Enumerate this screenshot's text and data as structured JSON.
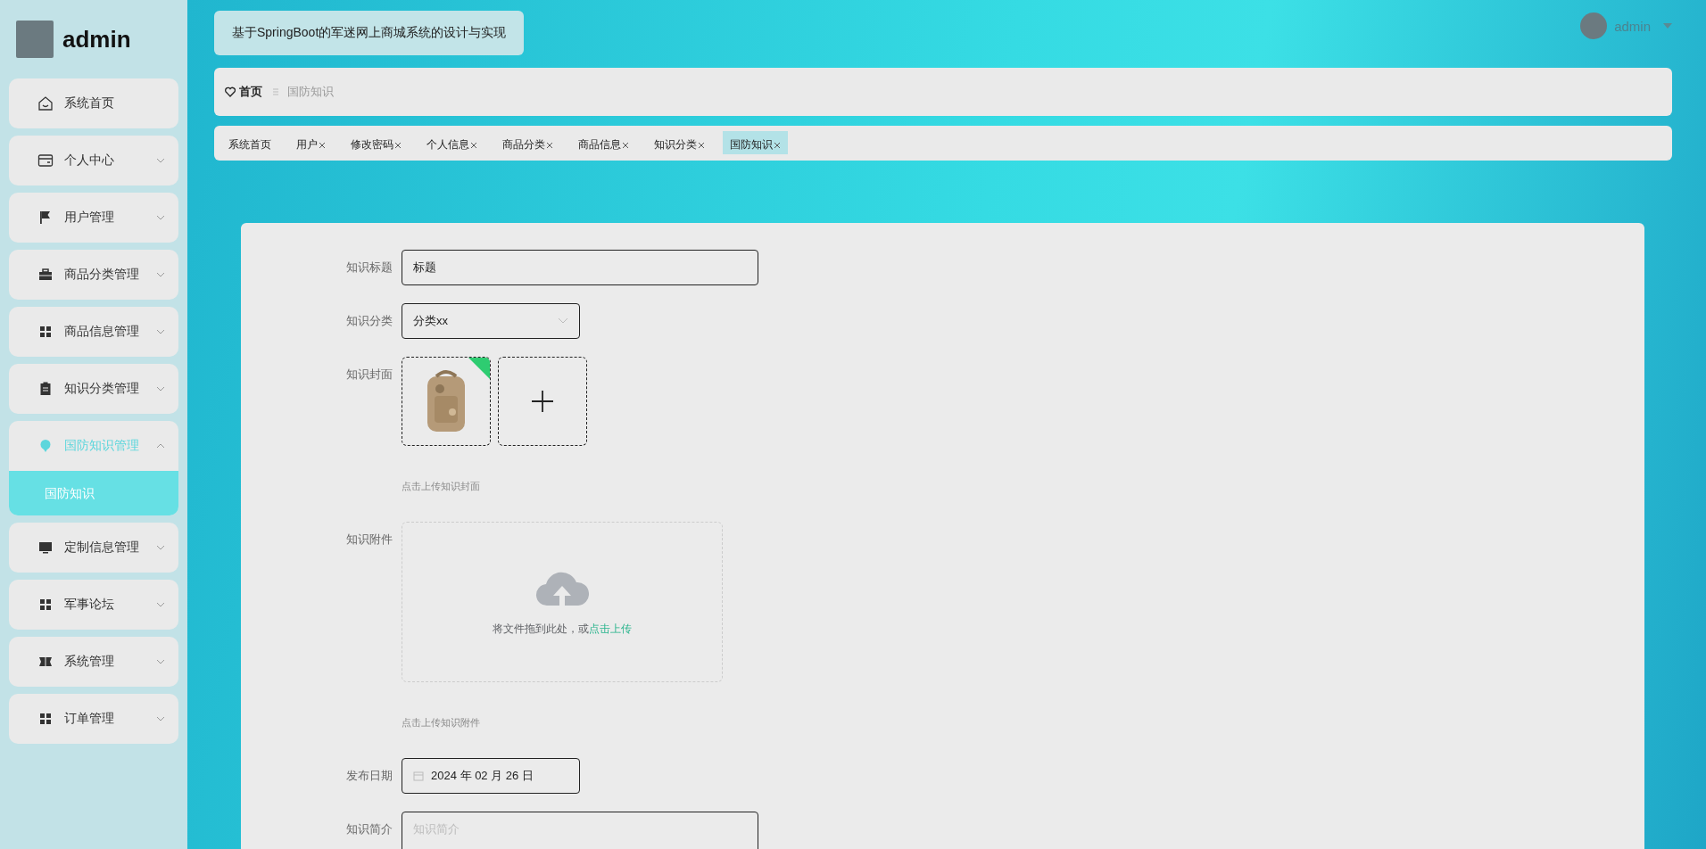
{
  "sidebar": {
    "username": "admin",
    "menu": [
      {
        "label": "系统首页",
        "kind": "link",
        "expanded": false
      },
      {
        "label": "个人中心",
        "kind": "submenu",
        "expanded": false
      },
      {
        "label": "用户管理",
        "kind": "submenu",
        "expanded": false
      },
      {
        "label": "商品分类管理",
        "kind": "submenu",
        "expanded": false
      },
      {
        "label": "商品信息管理",
        "kind": "submenu",
        "expanded": false
      },
      {
        "label": "知识分类管理",
        "kind": "submenu",
        "expanded": false
      },
      {
        "label": "国防知识管理",
        "kind": "submenu",
        "expanded": true,
        "children": [
          {
            "label": "国防知识",
            "selected": true
          }
        ]
      },
      {
        "label": "定制信息管理",
        "kind": "submenu",
        "expanded": false
      },
      {
        "label": "军事论坛",
        "kind": "submenu",
        "expanded": false
      },
      {
        "label": "系统管理",
        "kind": "submenu",
        "expanded": false
      },
      {
        "label": "订单管理",
        "kind": "submenu",
        "expanded": false
      }
    ]
  },
  "header": {
    "title": "基于SpringBoot的军迷网上商城系统的设计与实现",
    "user": "admin"
  },
  "breadcrumb": [
    "首页",
    "国防知识"
  ],
  "tabs": [
    {
      "label": "系统首页",
      "closable": false,
      "selected": false
    },
    {
      "label": "用户",
      "closable": true,
      "selected": false
    },
    {
      "label": "修改密码",
      "closable": true,
      "selected": false
    },
    {
      "label": "个人信息",
      "closable": true,
      "selected": false
    },
    {
      "label": "商品分类",
      "closable": true,
      "selected": false
    },
    {
      "label": "商品信息",
      "closable": true,
      "selected": false
    },
    {
      "label": "知识分类",
      "closable": true,
      "selected": false
    },
    {
      "label": "国防知识",
      "closable": true,
      "selected": true
    }
  ],
  "form": [
    {
      "kind": "text",
      "label": "知识标题",
      "value": "标题"
    },
    {
      "kind": "select",
      "label": "知识分类",
      "value": "分类xx"
    },
    {
      "kind": "image_upload",
      "label": "知识封面",
      "uploaded": true,
      "hint": "点击上传知识封面"
    },
    {
      "kind": "file_upload",
      "label": "知识附件",
      "text": "将文件拖到此处，或",
      "link": "点击上传",
      "hint": "点击上传知识附件"
    },
    {
      "kind": "date",
      "label": "发布日期",
      "value": "2024 年 02 月 26 日"
    },
    {
      "kind": "textarea",
      "label": "知识简介",
      "placeholder": "知识简介"
    }
  ]
}
